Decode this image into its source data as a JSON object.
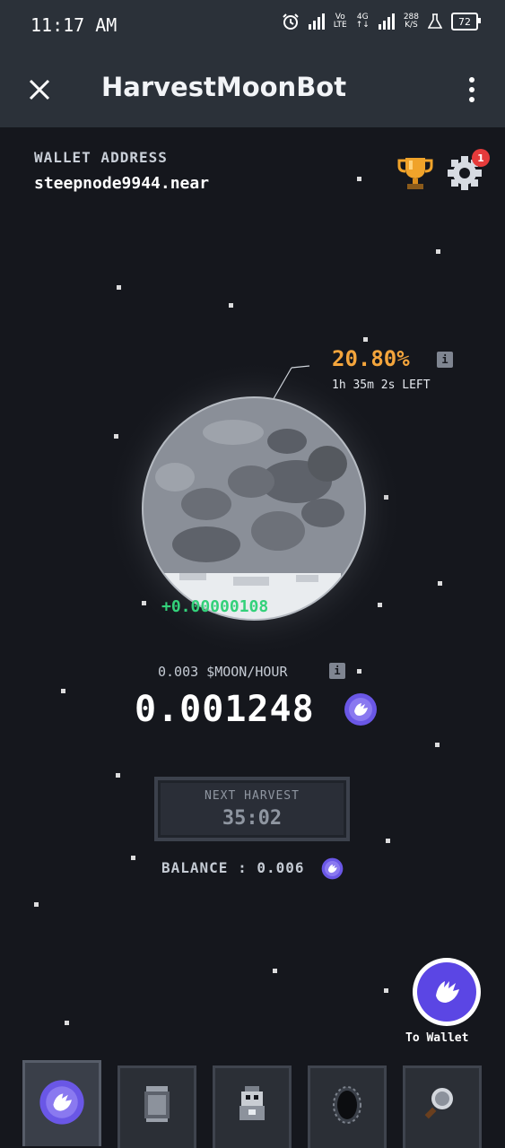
{
  "status_bar": {
    "time": "11:17 AM",
    "network_speed_value": "288",
    "network_speed_unit": "K/S",
    "net_vo": "Vo",
    "net_lte": "LTE",
    "net_4g": "4G",
    "battery": "72",
    "icons": [
      "alarm-icon",
      "signal-icon",
      "signal-icon",
      "flask-icon",
      "battery-icon"
    ]
  },
  "app_bar": {
    "title": "HarvestMoonBot",
    "close_icon": "close-icon",
    "menu_icon": "more-vertical-icon"
  },
  "wallet": {
    "label": "WALLET ADDRESS",
    "address": "steepnode9944.near",
    "settings_badge": "1"
  },
  "moon": {
    "percent": "20.80%",
    "time_left": "1h 35m 2s LEFT",
    "gain": "+0.00000108",
    "fill_fraction": 0.208
  },
  "mining": {
    "rate": "0.003 $MOON/HOUR",
    "value": "0.001248"
  },
  "harvest": {
    "label": "NEXT HARVEST",
    "time": "35:02"
  },
  "balance": {
    "label": "BALANCE : 0.006"
  },
  "to_wallet": {
    "label": "To Wallet"
  },
  "tabs": [
    {
      "name": "moon-tab",
      "icon": "moon-token-icon",
      "active": true
    },
    {
      "name": "storage-tab",
      "icon": "storage-jar-icon",
      "active": false
    },
    {
      "name": "robot-tab",
      "icon": "robot-icon",
      "active": false
    },
    {
      "name": "portal-tab",
      "icon": "black-hole-icon",
      "active": false
    },
    {
      "name": "search-tab",
      "icon": "magnifier-icon",
      "active": false
    }
  ],
  "colors": {
    "background": "#15171d",
    "bar": "#2b3139",
    "accent": "#5b46e4",
    "percent": "#f4a53c",
    "gain": "#33d17a"
  }
}
